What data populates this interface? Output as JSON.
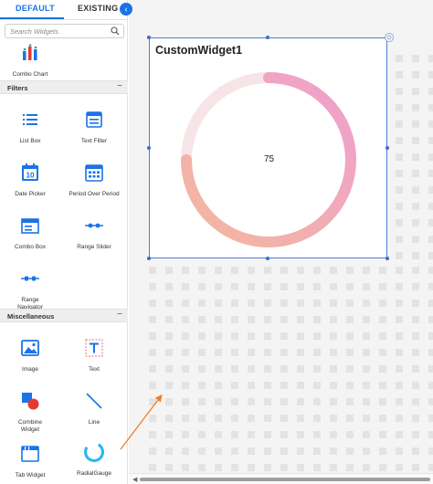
{
  "tabs": {
    "default_label": "DEFAULT",
    "existing_label": "EXISTING"
  },
  "collapse_glyph": "‹",
  "search": {
    "placeholder": "Search Widgets"
  },
  "widgets_top": [
    {
      "label": "Combo Chart",
      "icon": "combo-chart-icon"
    }
  ],
  "sections": [
    {
      "title": "Filters",
      "collapse_glyph": "−",
      "items": [
        {
          "label": "List Box",
          "icon": "list-box-icon"
        },
        {
          "label": "Text Filter",
          "icon": "text-filter-icon"
        },
        {
          "label": "Date Picker",
          "icon": "date-picker-icon"
        },
        {
          "label": "Period Over Period",
          "icon": "period-over-period-icon"
        },
        {
          "label": "Combo Box",
          "icon": "combo-box-icon"
        },
        {
          "label": "Range Slider",
          "icon": "range-slider-icon"
        },
        {
          "label": "Range Navigator",
          "icon": "range-navigator-icon"
        }
      ]
    },
    {
      "title": "Miscellaneous",
      "collapse_glyph": "−",
      "items": [
        {
          "label": "Image",
          "icon": "image-icon"
        },
        {
          "label": "Text",
          "icon": "text-icon"
        },
        {
          "label": "Combine Widget",
          "icon": "combine-widget-icon"
        },
        {
          "label": "Line",
          "icon": "line-icon"
        },
        {
          "label": "Tab Widget",
          "icon": "tab-widget-icon"
        },
        {
          "label": "RadialGauge",
          "icon": "radial-gauge-icon"
        }
      ]
    }
  ],
  "canvas_widget": {
    "title": "CustomWidget1",
    "gauge": {
      "value": "75",
      "fraction": 0.75
    },
    "colors": {
      "gradient_start": "#f4b89e",
      "gradient_end": "#ee9fcf",
      "track": "#f7e4e6",
      "border": "#4a7fd4"
    }
  },
  "colors": {
    "accent": "#1a73e8",
    "drag_arrow": "#f07d2a"
  },
  "scroll_left_glyph": "◀"
}
